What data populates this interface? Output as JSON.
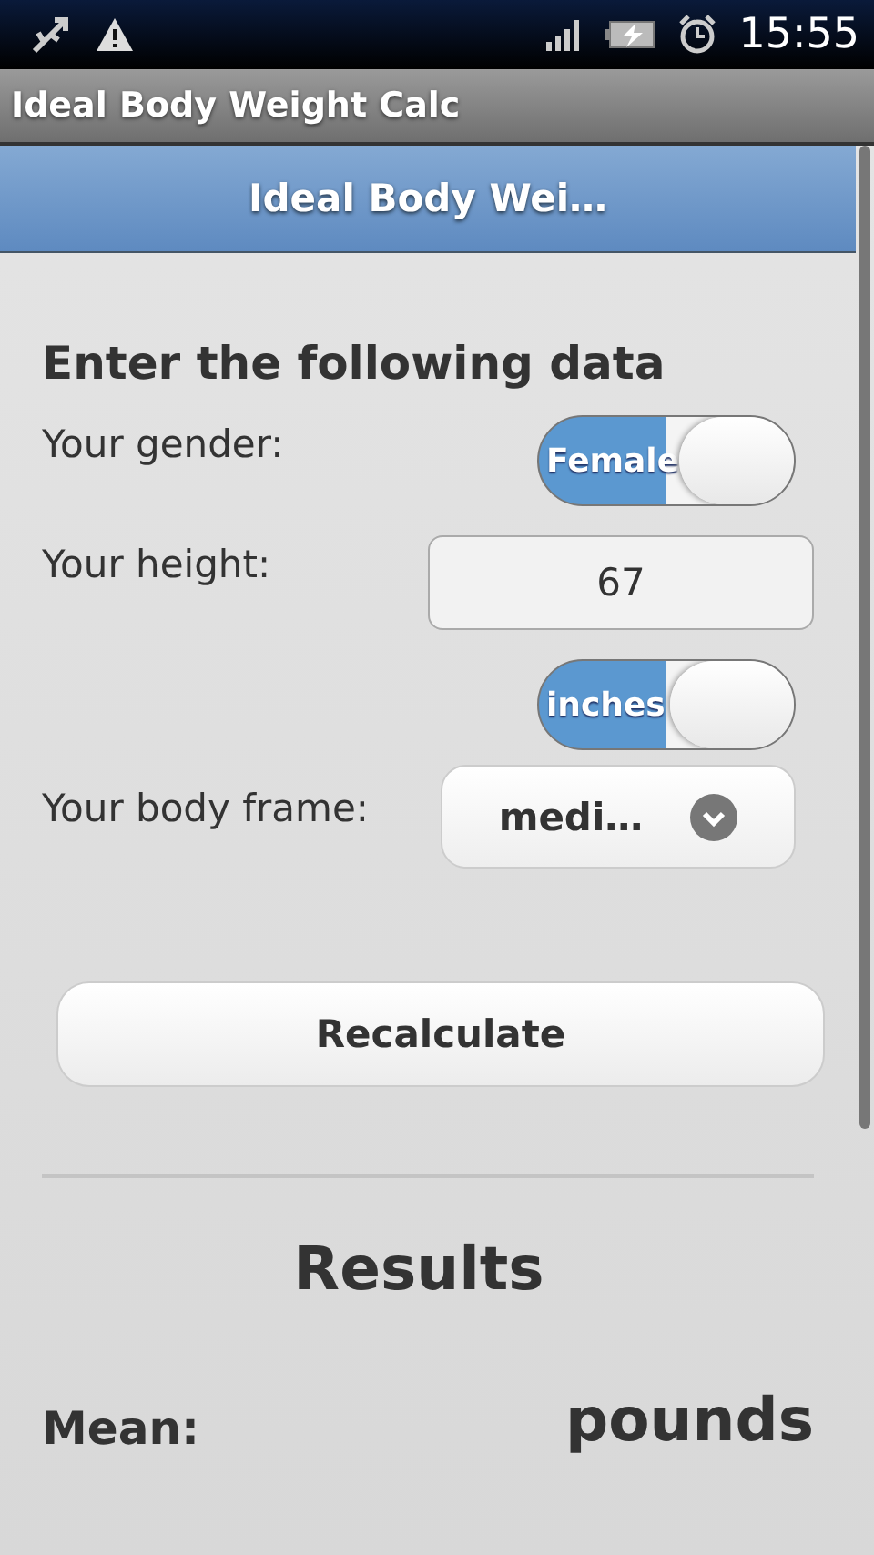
{
  "status_bar": {
    "time": "15:55"
  },
  "app_title": "Ideal Body Weight Calc",
  "header": {
    "title": "Ideal Body Wei…"
  },
  "form": {
    "heading": "Enter the following data",
    "rows": [
      {
        "kind": "toggle",
        "label": "Your gender:",
        "value": "Female",
        "on": true
      },
      {
        "kind": "input",
        "label": "Your height:",
        "value": "67"
      },
      {
        "kind": "toggle",
        "value": "inches",
        "on": true
      },
      {
        "kind": "select",
        "label": "Your body frame:",
        "value": "medi…"
      }
    ]
  },
  "button": {
    "label": "Recalculate"
  },
  "results": {
    "heading": "Results",
    "rows": [
      {
        "label": "Mean:",
        "value": "pounds"
      }
    ]
  }
}
